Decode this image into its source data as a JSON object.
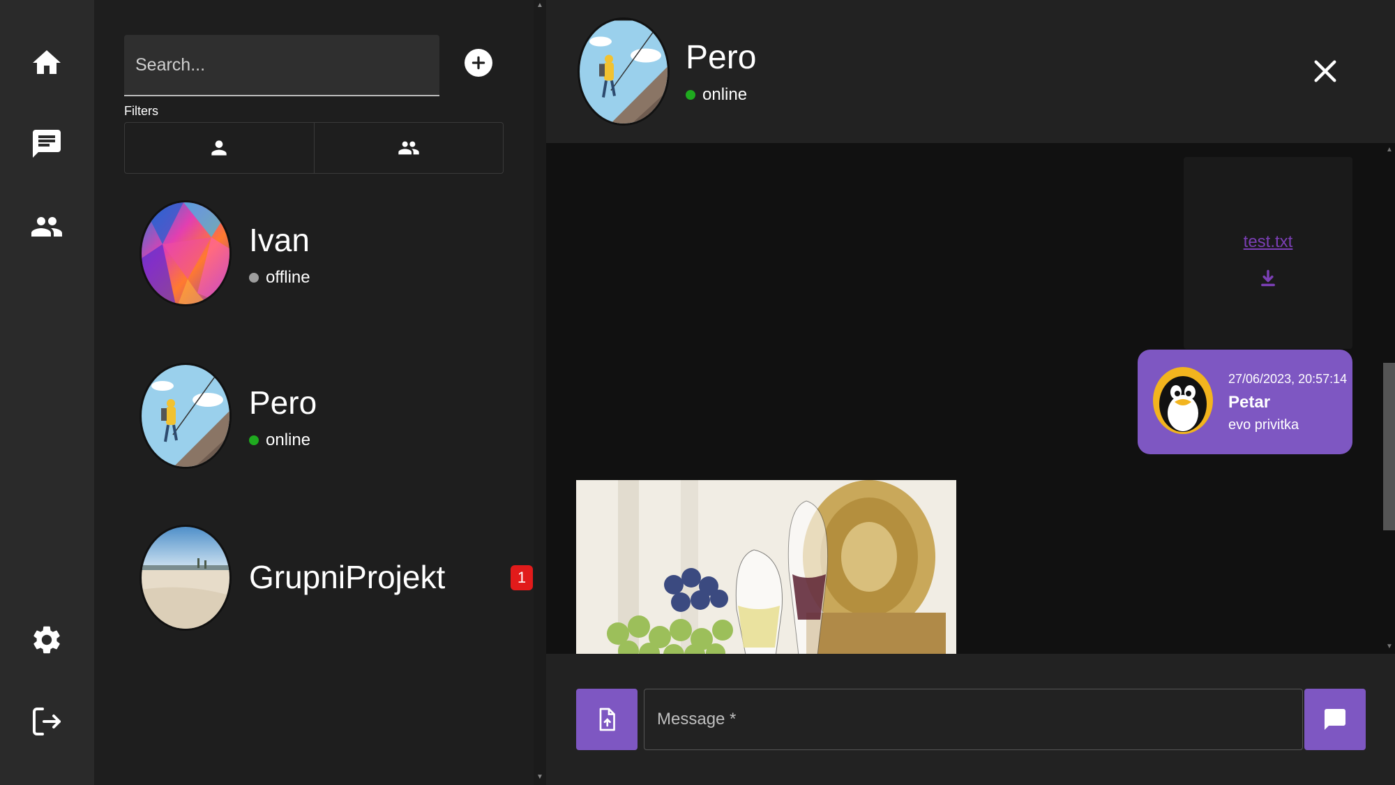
{
  "nav": {
    "items": [
      {
        "icon": "home-icon"
      },
      {
        "icon": "chat-icon"
      },
      {
        "icon": "group-icon"
      },
      {
        "icon": "gear-icon"
      },
      {
        "icon": "logout-icon"
      }
    ]
  },
  "search": {
    "placeholder": "Search...",
    "value": ""
  },
  "filters": {
    "label": "Filters"
  },
  "conversations": [
    {
      "name": "Ivan",
      "status": "offline",
      "status_color": "#9e9e9e"
    },
    {
      "name": "Pero",
      "status": "online",
      "status_color": "#1faa1f"
    },
    {
      "name": "GrupniProjekt",
      "badge": "1"
    }
  ],
  "chat": {
    "name": "Pero",
    "status": "online",
    "status_color": "#1faa1f"
  },
  "messages": {
    "file": {
      "name": "test.txt"
    },
    "bubble": {
      "time": "27/06/2023, 20:57:14",
      "user": "Petar",
      "text": "evo privitka"
    }
  },
  "composer": {
    "placeholder": "Message *",
    "value": ""
  },
  "colors": {
    "accent": "#7e57c2",
    "badge": "#e11b1b",
    "link": "#7b3fb5"
  }
}
